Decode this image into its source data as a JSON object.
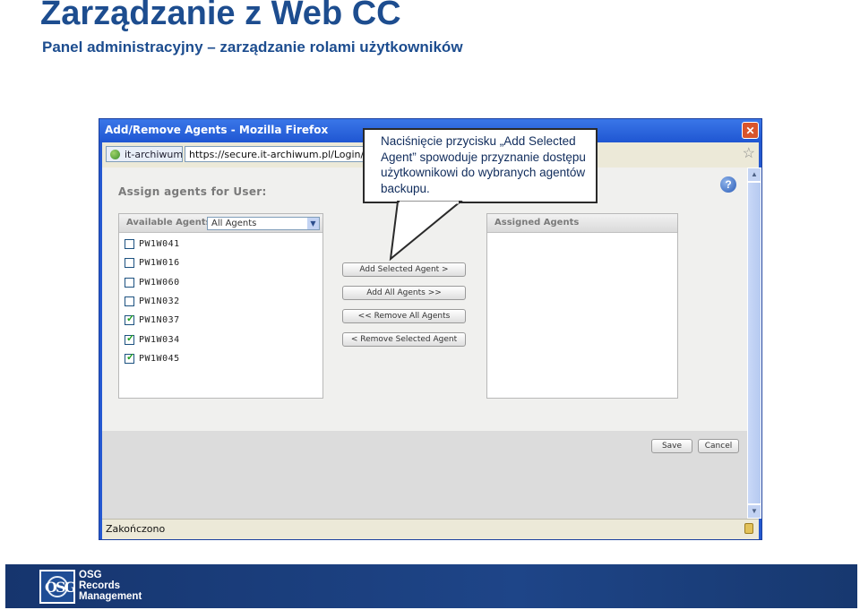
{
  "slide": {
    "title": "Zarządzanie z Web CC",
    "subtitle": "Panel administracyjny –  zarządzanie rolami użytkowników"
  },
  "window": {
    "title": "Add/Remove Agents - Mozilla Firefox",
    "site_badge": "it-archiwum.pl",
    "url": "https://secure.it-archiwum.pl/Login/Pages/U",
    "close_symbol": "✕",
    "status": "Zakończono"
  },
  "form": {
    "assign_label": "Assign agents for User:",
    "help_symbol": "?",
    "available_header": "Available Agents",
    "filter_value": "All Agents",
    "assigned_header": "Assigned Agents",
    "agents": [
      {
        "name": "PW1W041",
        "checked": false
      },
      {
        "name": "PW1W016",
        "checked": false
      },
      {
        "name": "PW1W060",
        "checked": false
      },
      {
        "name": "PW1N032",
        "checked": false
      },
      {
        "name": "PW1N037",
        "checked": true
      },
      {
        "name": "PW1W034",
        "checked": true
      },
      {
        "name": "PW1W045",
        "checked": true
      }
    ],
    "buttons": {
      "add_selected": "Add Selected Agent >",
      "add_all": "Add All Agents >>",
      "remove_all": "<< Remove All Agents",
      "remove_selected": "< Remove Selected Agent",
      "save": "Save",
      "cancel": "Cancel"
    }
  },
  "callout": {
    "text": "Naciśnięcie przycisku „Add Selected Agent” spowoduje przyznanie dostępu użytkownikowi do wybranych agentów backupu."
  },
  "footer": {
    "logo_letters": "OSG",
    "logo_line1": "OSG",
    "logo_line2": "Records",
    "logo_line3": "Management"
  },
  "icons": {
    "window_icon": "close-icon",
    "help": "help-icon",
    "checkbox_checked": "check-icon",
    "status_lock": "lock-icon"
  }
}
